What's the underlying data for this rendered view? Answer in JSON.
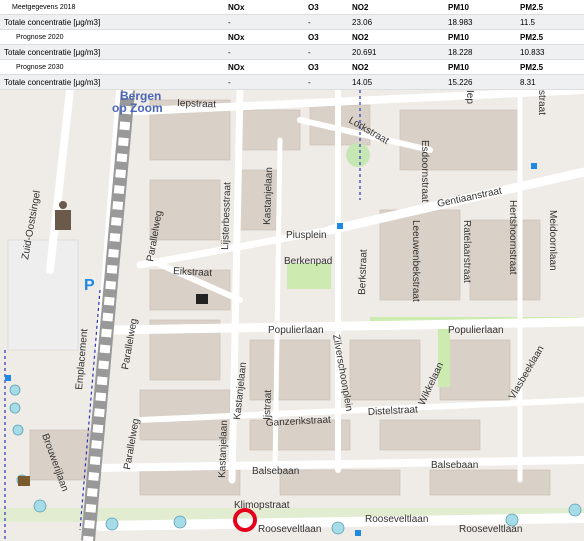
{
  "tables": [
    {
      "label": "Meetgegevens 2018",
      "row_label": "Totale concentratie [μg/m3]",
      "headers": [
        "NOx",
        "O3",
        "NO2",
        "PM10",
        "PM2.5"
      ],
      "values": [
        "-",
        "-",
        "23.06",
        "18.983",
        "11.5"
      ]
    },
    {
      "label": "Prognose 2020",
      "row_label": "Totale concentratie [μg/m3]",
      "headers": [
        "NOx",
        "O3",
        "NO2",
        "PM10",
        "PM2.5"
      ],
      "values": [
        "-",
        "-",
        "20.691",
        "18.228",
        "10.833"
      ]
    },
    {
      "label": "Prognose 2030",
      "row_label": "Totale concentratie [μg/m3]",
      "headers": [
        "NOx",
        "O3",
        "NO2",
        "PM10",
        "PM2.5"
      ],
      "values": [
        "-",
        "-",
        "14.05",
        "15.226",
        "8.31"
      ]
    }
  ],
  "map": {
    "city_label_1": "Bergen",
    "city_label_2": "op Zoom",
    "parking_symbol": "P",
    "streets": {
      "iepstraat": "Iepstraat",
      "lorkstraat": "Lorkstraat",
      "esdoornstraat": "Esdoornstraat",
      "zuid_oostsingel": "Zuid-Oostsingel",
      "lijsterbesstraat": "Lijsterbesstraat",
      "kastanjelaan_top": "Kastanjelaan",
      "parallelweg_top": "Parallelweg",
      "gentiaanstraat": "Gentiaanstraat",
      "piusplein": "Piusplein",
      "berkenpad": "Berkenpad",
      "leeuwenbekstraat": "Leeuwenbekstraat",
      "ratelaarstraat": "Ratelaarstraat",
      "hertshoornstraat": "Hertshoornstraat",
      "meidoornlaan": "Meidoornlaan",
      "eikstraat": "Eikstraat",
      "berkstraat": "Berkstraat",
      "emplacement": "Emplacement",
      "parallelweg_mid": "Parallelweg",
      "populierlaan_mid": "Populierlaan",
      "populierlaan_right": "Populierlaan",
      "zilverschoonplein": "Zilverschoonplein",
      "kastanjelaan_mid": "Kastanjelaan",
      "ijstraat": "Ijstraat",
      "wikkelaan": "Wikkelaan",
      "vlasbeeklaan": "Vlasbeeklaan",
      "parallelweg_low": "Parallelweg",
      "ganzerikstraat": "Ganzerikstraat",
      "distelstraat": "Distelstraat",
      "brouwerijlaan": "Brouwerijlaan",
      "kastanjelaan_low": "Kastanjelaan",
      "balsebaan_left": "Balsebaan",
      "balsebaan_right": "Balsebaan",
      "klimopstraat": "Klimopstraat",
      "rooseveltlaan_1": "Rooseveltlaan",
      "rooseveltlaan_2": "Rooseveltlaan",
      "rooseveltlaan_3": "Rooseveltlaan",
      "top_fragment_1": "Iep",
      "top_fragment_2": "straat"
    }
  }
}
